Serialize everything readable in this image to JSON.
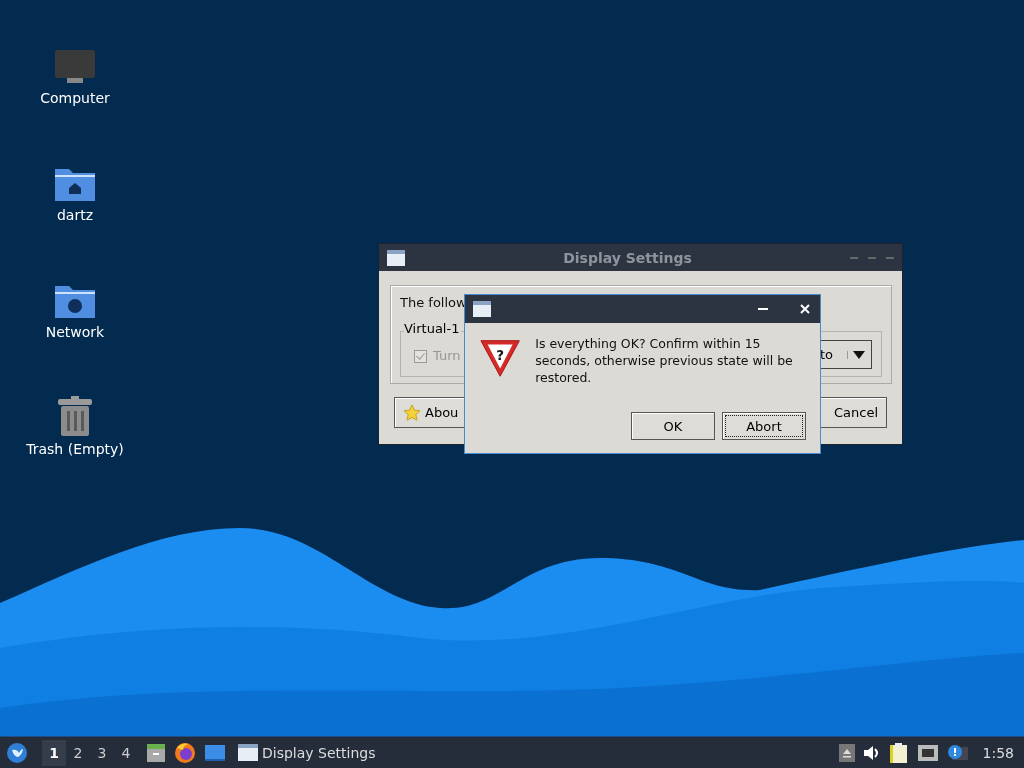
{
  "desktop_icons": [
    {
      "kind": "computer",
      "label": "Computer"
    },
    {
      "kind": "home",
      "label": "dartz"
    },
    {
      "kind": "network",
      "label": "Network"
    },
    {
      "kind": "trash",
      "label": "Trash (Empty)"
    }
  ],
  "back_window": {
    "title": "Display Settings",
    "intro": "The follow",
    "group": "Virtual-1",
    "checkbox": {
      "label": "Turn",
      "checked": true,
      "disabled": true
    },
    "combo": {
      "value": "to"
    },
    "buttons": [
      {
        "kind": "about",
        "label": "Abou"
      },
      {
        "kind": "cancel",
        "label": "Cancel"
      }
    ]
  },
  "dialog": {
    "icon_glyph": "?",
    "message": "Is everything OK? Confirm within 15 seconds, otherwise previous state will be restored.",
    "buttons": [
      {
        "label": "OK",
        "focused": false
      },
      {
        "label": "Abort",
        "focused": true
      }
    ]
  },
  "taskbar": {
    "workspaces": [
      {
        "label": "1",
        "selected": true
      },
      {
        "label": "2",
        "selected": false
      },
      {
        "label": "3",
        "selected": false
      },
      {
        "label": "4",
        "selected": false
      }
    ],
    "launchers": [
      {
        "kind": "files"
      },
      {
        "kind": "browser"
      },
      {
        "kind": "desktop"
      }
    ],
    "task": {
      "label": "Display Settings"
    },
    "clock": "1:58"
  }
}
